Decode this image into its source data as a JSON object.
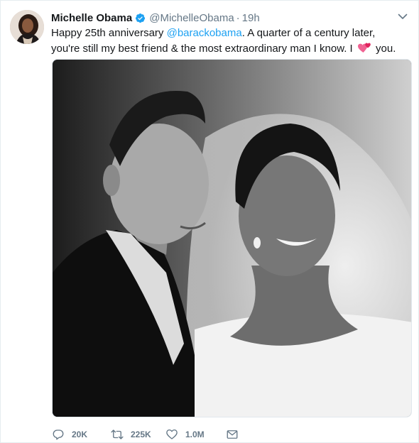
{
  "tweet": {
    "author_name": "Michelle Obama",
    "verified": true,
    "handle": "@MichelleObama",
    "separator": "·",
    "time": "19h",
    "text_part1": "Happy 25th anniversary ",
    "mention": "@barackobama",
    "text_part2": ". A quarter of a century later, you're still my best friend & the most extraordinary man I know. I ",
    "emoji": "two-hearts",
    "text_part3": " you."
  },
  "actions": {
    "replies": "20K",
    "retweets": "225K",
    "likes": "1.0M"
  },
  "colors": {
    "link": "#1da1f2",
    "verified": "#1da1f2",
    "muted": "#657786",
    "heart": "#e0245e"
  },
  "icons": {
    "reply": "reply-icon",
    "retweet": "retweet-icon",
    "like": "heart-icon",
    "dm": "envelope-icon",
    "menu": "chevron-down-icon",
    "verified": "verified-badge-icon"
  },
  "media": {
    "description_kind": "black-and-white wedding photograph"
  }
}
